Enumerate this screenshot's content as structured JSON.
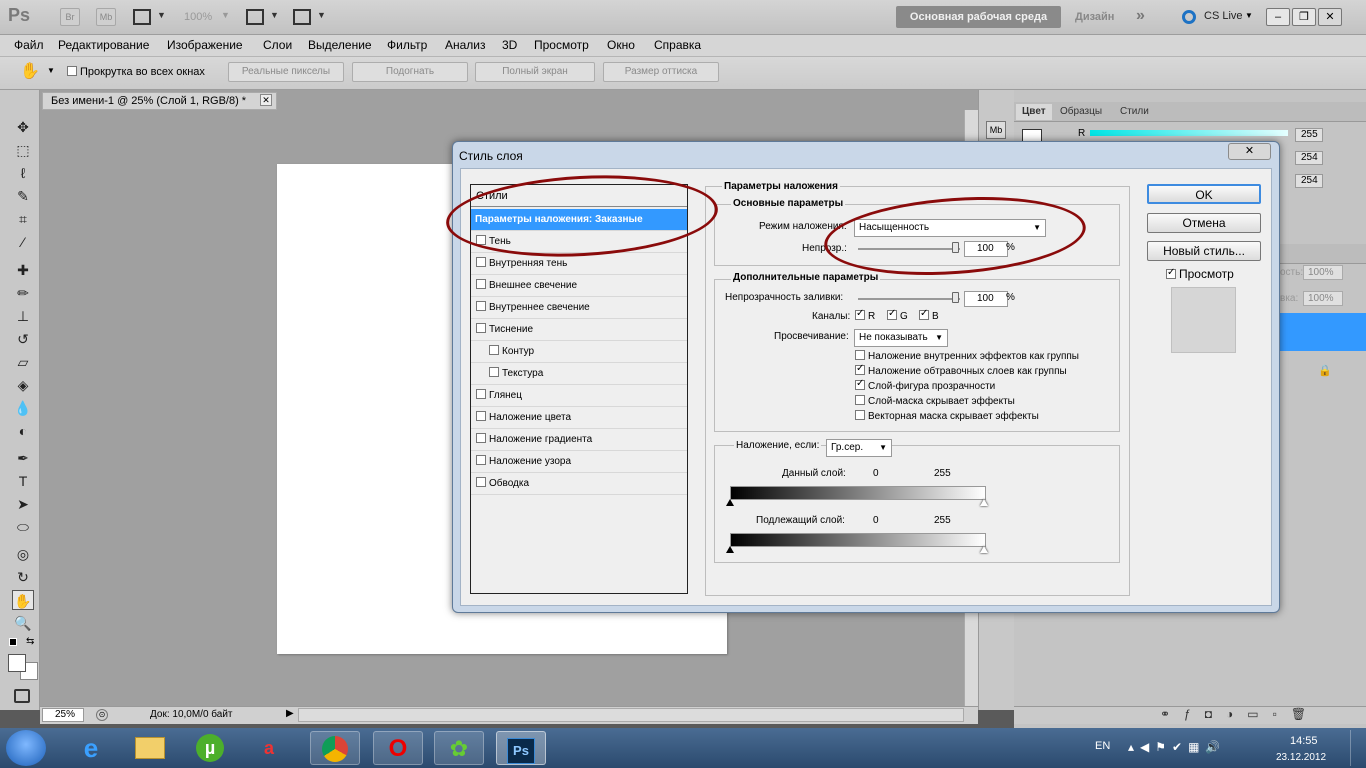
{
  "app": {
    "logo": "Ps",
    "launch_buttons": [
      "Br",
      "Mb"
    ],
    "zoom_level": "100%",
    "workspace": "Основная рабочая среда",
    "workspace_alt": "Дизайн",
    "more": "»",
    "cs_live": "CS Live",
    "window_controls": [
      "–",
      "❐",
      "✕"
    ]
  },
  "menu": [
    "Файл",
    "Редактирование",
    "Изображение",
    "Слои",
    "Выделение",
    "Фильтр",
    "Анализ",
    "3D",
    "Просмотр",
    "Окно",
    "Справка"
  ],
  "options": {
    "scroll_all": "Прокрутка во всех окнах",
    "buttons": [
      "Реальные пикселы",
      "Подогнать",
      "Полный экран",
      "Размер оттиска"
    ]
  },
  "document": {
    "tab_title": "Без имени-1 @ 25% (Слой 1, RGB/8) *",
    "zoom": "25%",
    "info": "Док: 10,0M/0 байт"
  },
  "panels": {
    "tabs": [
      "Цвет",
      "Образцы",
      "Стили"
    ],
    "channel_r": "R",
    "values": [
      "255",
      "254",
      "254"
    ],
    "opacity_1": "100%",
    "opacity_2": "100%",
    "opacity_label_1": "ость:",
    "opacity_label_2": "вка:"
  },
  "dialog": {
    "title": "Стиль слоя",
    "close": "✕",
    "styles_header": "Стили",
    "styles": [
      {
        "label": "Параметры наложения: Заказные",
        "selected": true,
        "checkbox": false,
        "indent": false
      },
      {
        "label": "Тень",
        "checkbox": true,
        "checked": false,
        "indent": false
      },
      {
        "label": "Внутренняя тень",
        "checkbox": true,
        "checked": false,
        "indent": false
      },
      {
        "label": "Внешнее свечение",
        "checkbox": true,
        "checked": false,
        "indent": false
      },
      {
        "label": "Внутреннее свечение",
        "checkbox": true,
        "checked": false,
        "indent": false
      },
      {
        "label": "Тиснение",
        "checkbox": true,
        "checked": false,
        "indent": false
      },
      {
        "label": "Контур",
        "checkbox": true,
        "checked": false,
        "indent": true
      },
      {
        "label": "Текстура",
        "checkbox": true,
        "checked": false,
        "indent": true
      },
      {
        "label": "Глянец",
        "checkbox": true,
        "checked": false,
        "indent": false
      },
      {
        "label": "Наложение цвета",
        "checkbox": true,
        "checked": false,
        "indent": false
      },
      {
        "label": "Наложение градиента",
        "checkbox": true,
        "checked": false,
        "indent": false
      },
      {
        "label": "Наложение узора",
        "checkbox": true,
        "checked": false,
        "indent": false
      },
      {
        "label": "Обводка",
        "checkbox": true,
        "checked": false,
        "indent": false
      }
    ],
    "blend_section": "Параметры наложения",
    "basic_section": "Основные параметры",
    "blend_mode_label": "Режим наложения:",
    "blend_mode_value": "Насыщенность",
    "opacity_label": "Непрозр.:",
    "opacity_value": "100",
    "percent": "%",
    "advanced_section": "Дополнительные параметры",
    "fill_opacity_label": "Непрозрачность заливки:",
    "fill_opacity_value": "100",
    "channels_label": "Каналы:",
    "channels": [
      "R",
      "G",
      "B"
    ],
    "knockout_label": "Просвечивание:",
    "knockout_value": "Не показывать",
    "advanced_options": [
      {
        "label": "Наложение внутренних эффектов как группы",
        "checked": false
      },
      {
        "label": "Наложение обтравочных слоев как группы",
        "checked": true
      },
      {
        "label": "Слой-фигура прозрачности",
        "checked": true
      },
      {
        "label": "Слой-маска скрывает эффекты",
        "checked": false
      },
      {
        "label": "Векторная маска скрывает эффекты",
        "checked": false
      }
    ],
    "blend_if_label": "Наложение, если:",
    "blend_if_value": "Гр.сер.",
    "this_layer_label": "Данный слой:",
    "underlying_label": "Подлежащий слой:",
    "range_min": "0",
    "range_max": "255",
    "ok": "OK",
    "cancel": "Отмена",
    "new_style": "Новый стиль...",
    "preview": "Просмотр"
  },
  "taskbar": {
    "lang": "EN",
    "time": "14:55",
    "date": "23.12.2012"
  },
  "colors": {
    "selection": "#3399ff",
    "annotation_red": "#8a0b0b",
    "taskbar": "#2b4a6e"
  }
}
